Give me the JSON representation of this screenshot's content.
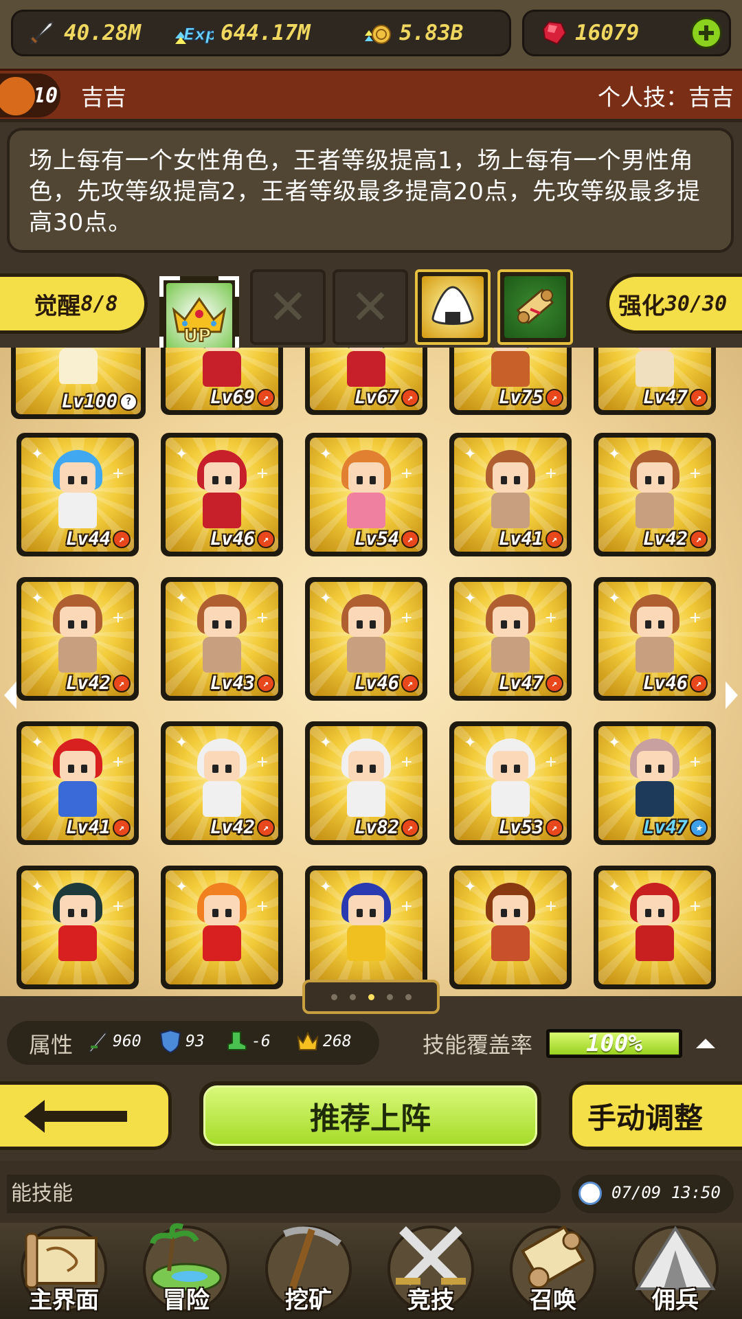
{
  "resources": {
    "attack": "40.28M",
    "exp": "644.17M",
    "gold": "5.83B",
    "gems": "16079"
  },
  "hero": {
    "level": "10",
    "name": "吉吉",
    "skill_title": "个人技：吉吉",
    "description": "场上每有一个女性角色，王者等级提高1，场上每有一个男性角色，先攻等级提高2，王者等级最多提高20点，先攻等级最多提高30点。"
  },
  "skill_bar": {
    "awaken_label": "觉醒",
    "awaken_value": "8/8",
    "enhance_label": "强化",
    "enhance_value": "30/30",
    "slots": [
      "crown-up-icon",
      "empty",
      "empty",
      "rice-ball-icon",
      "scroll-icon"
    ]
  },
  "units": [
    {
      "lv": "Lv100",
      "mark": "question"
    },
    {
      "lv": "Lv69",
      "mark": "fire"
    },
    {
      "lv": "Lv67",
      "mark": "fire"
    },
    {
      "lv": "Lv75",
      "mark": "fire"
    },
    {
      "lv": "Lv47",
      "mark": "fire"
    },
    {
      "lv": "Lv44",
      "mark": "fire"
    },
    {
      "lv": "Lv46",
      "mark": "fire"
    },
    {
      "lv": "Lv54",
      "mark": "fire"
    },
    {
      "lv": "Lv41",
      "mark": "fire"
    },
    {
      "lv": "Lv42",
      "mark": "fire"
    },
    {
      "lv": "Lv42",
      "mark": "fire"
    },
    {
      "lv": "Lv43",
      "mark": "fire"
    },
    {
      "lv": "Lv46",
      "mark": "fire"
    },
    {
      "lv": "Lv47",
      "mark": "fire"
    },
    {
      "lv": "Lv46",
      "mark": "fire"
    },
    {
      "lv": "Lv41",
      "mark": "fire"
    },
    {
      "lv": "Lv42",
      "mark": "fire"
    },
    {
      "lv": "Lv82",
      "mark": "fire"
    },
    {
      "lv": "Lv53",
      "mark": "fire"
    },
    {
      "lv": "Lv47",
      "mark": "star"
    },
    {
      "lv": "",
      "mark": ""
    },
    {
      "lv": "",
      "mark": ""
    },
    {
      "lv": "",
      "mark": ""
    },
    {
      "lv": "",
      "mark": ""
    },
    {
      "lv": "",
      "mark": ""
    }
  ],
  "pagination": {
    "pages": 5,
    "current": 3
  },
  "attributes": {
    "label": "属性",
    "sword": "960",
    "shield": "93",
    "boot": "-6",
    "crown": "268",
    "coverage_label": "技能覆盖率",
    "coverage_value": "100%",
    "coverage_fraction": 1.0
  },
  "actions": {
    "recommend": "推荐上阵",
    "manual": "手动调整"
  },
  "status": {
    "ticker": "能技能",
    "time": "07/09 13:50"
  },
  "nav": [
    {
      "label": "主界面",
      "icon": "map-scroll-icon"
    },
    {
      "label": "冒险",
      "icon": "island-icon"
    },
    {
      "label": "挖矿",
      "icon": "pickaxe-icon"
    },
    {
      "label": "竞技",
      "icon": "crossed-swords-icon"
    },
    {
      "label": "召唤",
      "icon": "summon-scroll-icon"
    },
    {
      "label": "佣兵",
      "icon": "tent-icon"
    }
  ],
  "colors": {
    "accent_yellow": "#f5df48",
    "accent_green": "#a6dc2a",
    "title_red": "#7a2e16",
    "resource_text": "#f0d860"
  }
}
